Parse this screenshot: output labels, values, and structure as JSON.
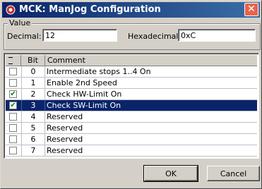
{
  "window": {
    "title": "MCK: ManJog Configuration",
    "close_glyph": "✕"
  },
  "value_group": {
    "legend": "Value",
    "decimal_label": "Decimal:",
    "decimal_value": "12",
    "hex_label": "Hexadecimal:",
    "hex_value": "0xC"
  },
  "table": {
    "headers": [
      "Bit",
      "Comment"
    ],
    "rows": [
      {
        "checked": false,
        "bit": "0",
        "comment": "Intermediate stops 1..4 On",
        "selected": false
      },
      {
        "checked": false,
        "bit": "1",
        "comment": "Enable 2nd Speed",
        "selected": false
      },
      {
        "checked": true,
        "bit": "2",
        "comment": "Check HW-Limit On",
        "selected": false
      },
      {
        "checked": true,
        "bit": "3",
        "comment": "Check SW-Limit On",
        "selected": true
      },
      {
        "checked": false,
        "bit": "4",
        "comment": "Reserved",
        "selected": false
      },
      {
        "checked": false,
        "bit": "5",
        "comment": "Reserved",
        "selected": false
      },
      {
        "checked": false,
        "bit": "6",
        "comment": "Reserved",
        "selected": false
      },
      {
        "checked": false,
        "bit": "7",
        "comment": "Reserved",
        "selected": false
      }
    ]
  },
  "buttons": {
    "ok": "OK",
    "cancel": "Cancel"
  }
}
